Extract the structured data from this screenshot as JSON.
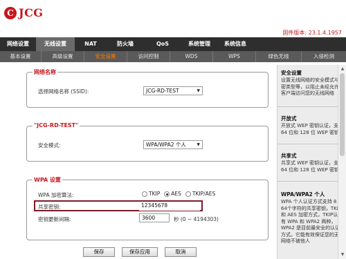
{
  "brand": {
    "logo_mark": "C",
    "logo_text": "JCG",
    "color": "#c8161d"
  },
  "firmware": "固件版本: 23.1.4.1957",
  "main_nav": [
    {
      "label": "网络设置",
      "active": false
    },
    {
      "label": "无线设置",
      "active": true
    },
    {
      "label": "NAT",
      "active": false
    },
    {
      "label": "防火墙",
      "active": false
    },
    {
      "label": "QoS",
      "active": false
    },
    {
      "label": "系统管理",
      "active": false
    },
    {
      "label": "系统信息",
      "active": false
    }
  ],
  "sub_nav": [
    {
      "label": "基本设置",
      "active": false
    },
    {
      "label": "高级设置",
      "active": false
    },
    {
      "label": "安全设置",
      "active": true
    },
    {
      "label": "访问控制",
      "active": false
    },
    {
      "label": "WDS",
      "active": false
    },
    {
      "label": "WPS",
      "active": false
    },
    {
      "label": "绿色无线",
      "active": false
    },
    {
      "label": "入侵检测",
      "active": false
    }
  ],
  "section_network": {
    "legend": "网络名称",
    "ssid_label": "选择网络名称 (SSID):",
    "ssid_value": "JCG-RD-TEST"
  },
  "section_ssid": {
    "legend": "\"JCG-RD-TEST\"",
    "mode_label": "安全模式:",
    "mode_value": "WPA/WPA2 个人"
  },
  "section_wpa": {
    "legend": "WPA 设置",
    "algo_label": "WPA 加密算法:",
    "algo_options": [
      "TKIP",
      "AES",
      "TKIP/AES"
    ],
    "algo_selected": "AES",
    "key_label": "共享密钥:",
    "key_value": "12345678",
    "interval_label": "密钥更新间隔:",
    "interval_value": "3600",
    "interval_unit": "秒 (0 ~ 4194303)"
  },
  "buttons": {
    "save": "保存",
    "save_apply": "保存应用",
    "cancel": "取消"
  },
  "help": {
    "security_title": "安全设置",
    "security_text": "设置无线网络的安全模式与加密类型等，以阻止未经允许的客户端访问您的无线网络",
    "open_title": "开放式",
    "open_text": "开放式 WEP 密钥认证，支持 64 位和 128 位 WEP 密钥",
    "shared_title": "共享式",
    "shared_text": "共享式 WEP 密钥认证，支持 64 位和 128 位 WEP 密钥",
    "wpa_title": "WPA/WPA2 个人",
    "wpa_text": "WPA 个人认证方式支持 8 到 64个字符的共享密钥，TKIP 和 AES 加密方式，TKIP认证有 WPA 和 WPA2 两种，WPA2 是目前最安全的认证方式。它能有效保证您的无线网络不被他人"
  }
}
